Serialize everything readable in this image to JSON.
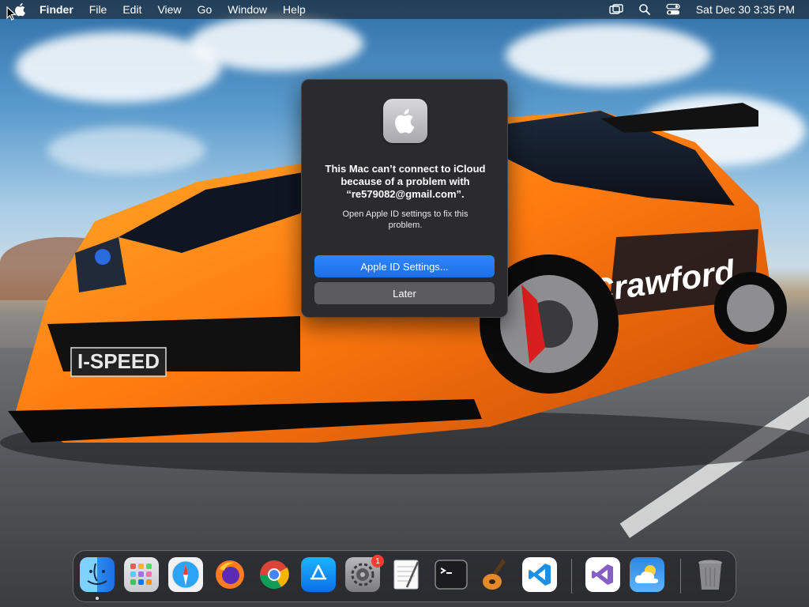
{
  "menubar": {
    "app_name": "Finder",
    "items": [
      "File",
      "Edit",
      "View",
      "Go",
      "Window",
      "Help"
    ],
    "clock": "Sat Dec 30  3:35 PM",
    "status_icons": [
      "screen-mirroring-icon",
      "spotlight-search-icon",
      "control-center-icon"
    ]
  },
  "dialog": {
    "title": "This Mac can’t connect to iCloud because of a problem with “re579082@gmail.com”.",
    "message": "Open Apple ID settings to fix this problem.",
    "primary_button": "Apple ID Settings...",
    "secondary_button": "Later",
    "accent_color": "#1b6fe6"
  },
  "dock": {
    "apps": [
      {
        "name": "finder-icon",
        "running": true
      },
      {
        "name": "launchpad-icon",
        "running": false
      },
      {
        "name": "safari-icon",
        "running": false
      },
      {
        "name": "firefox-icon",
        "running": false
      },
      {
        "name": "chrome-icon",
        "running": false
      },
      {
        "name": "app-store-icon",
        "running": false
      },
      {
        "name": "system-settings-icon",
        "running": false,
        "badge": "1"
      },
      {
        "name": "textedit-icon",
        "running": false
      },
      {
        "name": "terminal-icon",
        "running": false
      },
      {
        "name": "garageband-icon",
        "running": false
      },
      {
        "name": "vscode-icon",
        "running": false
      },
      {
        "name": "visual-studio-icon",
        "running": false
      },
      {
        "name": "weather-icon",
        "running": false
      },
      {
        "name": "trash-icon",
        "running": false
      }
    ]
  }
}
